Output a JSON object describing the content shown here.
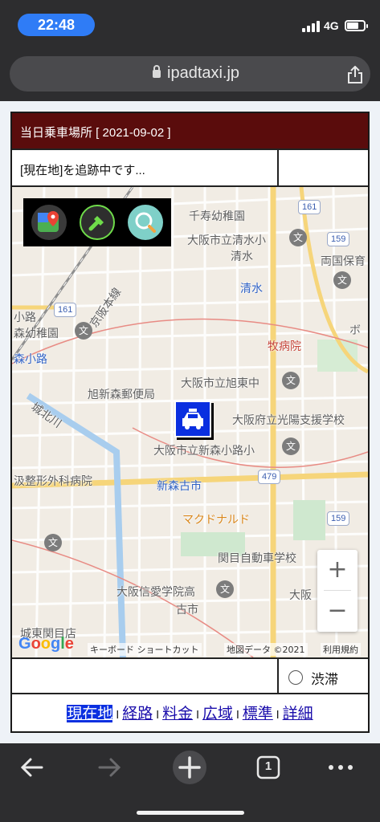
{
  "status_bar": {
    "time": "22:48",
    "network": "4G"
  },
  "browser": {
    "url": "ipadtaxi.jp",
    "tab_count": "1"
  },
  "header": {
    "title": "当日乗車場所 [ 2021-09-02 ]",
    "tracking_message": "[現在地]を追跡中です..."
  },
  "map": {
    "labels": {
      "kindergarten_senju": "千寿幼稚園",
      "shimizu_elementary": "大阪市立清水小",
      "shimizu_area": "清水",
      "shimizu_station": "清水",
      "ryoguchi_nursery": "両国保育",
      "kouji": "小路",
      "kindergarten_kouji": "森幼稚園",
      "morikouji_station": "森小路",
      "makino_hospital": "牧病院",
      "bo": "ボ",
      "asahi_post": "旭新森郵便局",
      "asahi_jhs": "大阪市立旭東中",
      "komyo_school": "大阪府立光陽支援学校",
      "joto_line": "城北川",
      "keihan_line": "京阪本線",
      "shinmori_elementary": "大阪市立新森小路小",
      "orthopedic_hospital": "汲整形外科病院",
      "shinmori_station": "新森古市",
      "mcdonalds": "マクドナルド",
      "kanjo_school": "関目自動車学校",
      "shinai_high": "大阪信愛学院高",
      "osaka_partial": "大阪",
      "furuichi": "古市",
      "joto_store": "城東関目店"
    },
    "route_numbers": {
      "r161a": "161",
      "r161b": "161",
      "r159a": "159",
      "r159b": "159",
      "r479": "479"
    },
    "footer": {
      "google": "Google",
      "keyboard_shortcuts": "キーボード ショートカット",
      "map_data": "地図データ ©2021",
      "terms": "利用規約"
    },
    "zoom_in": "+",
    "zoom_out": "−",
    "icons": [
      "google-maps-icon",
      "flashlight-icon",
      "search-icon",
      "taxi-icon"
    ]
  },
  "traffic": {
    "label": "渋滞",
    "checked": false
  },
  "nav": {
    "items": [
      {
        "label": "現在地",
        "active": true
      },
      {
        "label": "経路"
      },
      {
        "label": "料金"
      },
      {
        "label": "広域"
      },
      {
        "label": "標準"
      },
      {
        "label": "詳細"
      }
    ],
    "separator": "I"
  },
  "colors": {
    "title_bar": "#5a0c0c",
    "marker": "#0a2fe0",
    "link": "#1a0dab",
    "time_pill": "#2f7cf6"
  }
}
